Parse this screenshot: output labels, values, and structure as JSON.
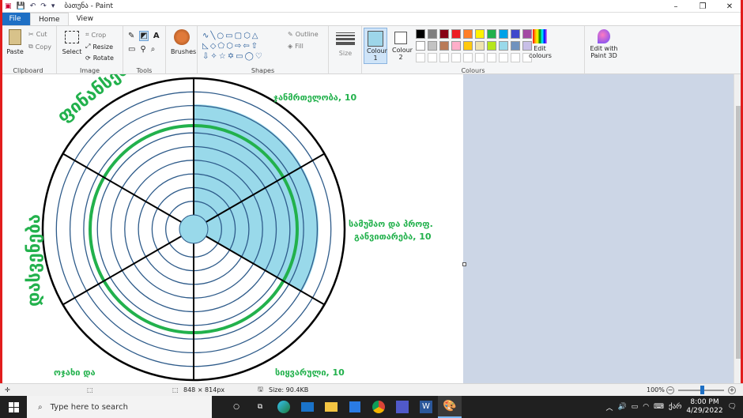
{
  "window": {
    "title": "ბათუნა - Paint",
    "controls": [
      "–",
      "❐",
      "✕"
    ]
  },
  "tabs": {
    "file": "File",
    "home": "Home",
    "view": "View"
  },
  "ribbon": {
    "clipboard": {
      "label": "Clipboard",
      "paste": "Paste",
      "cut": "Cut",
      "copy": "Copy"
    },
    "image": {
      "label": "Image",
      "select": "Select",
      "crop": "Crop",
      "resize": "Resize",
      "rotate": "Rotate"
    },
    "tools": {
      "label": "Tools"
    },
    "brushes": {
      "label": "Brushes"
    },
    "shapes": {
      "label": "Shapes",
      "outline": "Outline",
      "fill": "Fill"
    },
    "size": {
      "label": "Size"
    },
    "colours": {
      "label": "Colours",
      "colour1": "Colour 1",
      "colour2": "Colour 2",
      "edit": "Edit colours",
      "paint3d": "Edit with Paint 3D",
      "colour1_value": "#9dd6ea",
      "palette_row1": [
        "#000000",
        "#7f7f7f",
        "#880015",
        "#ed1c24",
        "#ff7f27",
        "#fff200",
        "#22b14c",
        "#00a2e8",
        "#3f48cc",
        "#a349a4"
      ],
      "palette_row2": [
        "#ffffff",
        "#c3c3c3",
        "#b97a57",
        "#ffaec9",
        "#ffc90e",
        "#efe4b0",
        "#b5e61d",
        "#99d9ea",
        "#7092be",
        "#c8bfe7"
      ]
    }
  },
  "drawing": {
    "labels": {
      "top_left_arc": "ფინანსები",
      "top_right": "ჯანმრთელობა, 10",
      "right_line1": "სამუშაო და პროფ.",
      "right_line2": "განვითარება, 10",
      "bottom_right": "სიყვარული, 10",
      "bottom_left": "ოჯახი და",
      "left_vertical": "დასვენება"
    },
    "colors": {
      "ring": "#2e5b8a",
      "green": "#22b14c",
      "fill": "#99d9ea"
    }
  },
  "statusbar": {
    "dimensions": "848 × 814px",
    "size": "Size: 90.4KB",
    "zoom": "100%"
  },
  "taskbar": {
    "search_placeholder": "Type here to search",
    "time": "8:00 PM",
    "date": "4/29/2022",
    "lang": "ქარ"
  }
}
